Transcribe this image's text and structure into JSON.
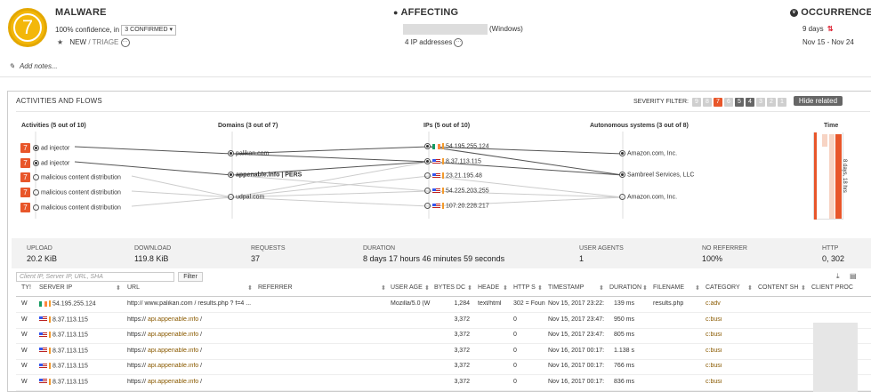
{
  "header": {
    "severity": "7",
    "title": "MALWARE",
    "confidence_text": "100% confidence, in",
    "confirmed_select": "3 CONFIRMED ▾",
    "status_new": "NEW",
    "status_triage": "/ TRIAGE",
    "add_notes": "Add notes...",
    "affecting_title": "AFFECTING",
    "affecting_os": "(Windows)",
    "affecting_ips": "4 IP addresses",
    "occurrence_title": "OCCURRENCE",
    "occurrence_days": "9 days",
    "occurrence_range": "Nov 15 - Nov 24"
  },
  "panel": {
    "title": "ACTIVITIES AND FLOWS",
    "severity_filter_label": "SEVERITY FILTER:",
    "severity_filter": [
      {
        "label": "9",
        "color": "#cfcfcf"
      },
      {
        "label": "8",
        "color": "#cfcfcf"
      },
      {
        "label": "7",
        "color": "#e8562a"
      },
      {
        "label": "6",
        "color": "#cfcfcf"
      },
      {
        "label": "5",
        "color": "#666666"
      },
      {
        "label": "4",
        "color": "#666666"
      },
      {
        "label": "3",
        "color": "#cfcfcf"
      },
      {
        "label": "2",
        "color": "#cfcfcf"
      },
      {
        "label": "1",
        "color": "#cfcfcf"
      }
    ],
    "hide_related": "Hide related"
  },
  "flows": {
    "activities_header": "Activities (5 out of 10)",
    "domains_header": "Domains (3 out of 7)",
    "ips_header": "IPs (5 out of 10)",
    "as_header": "Autonomous systems (3 out of 8)",
    "time_header": "Time",
    "time_label": "8 days, 18 hrs",
    "activities": [
      {
        "sev": "7",
        "label": "ad injector"
      },
      {
        "sev": "7",
        "label": "ad injector"
      },
      {
        "sev": "7",
        "label": "malicious content distribution"
      },
      {
        "sev": "7",
        "label": "malicious content distribution"
      },
      {
        "sev": "7",
        "label": "malicious content distribution"
      }
    ],
    "domains": [
      "palikan.com",
      "appenable.info | PERS",
      "udpal.com"
    ],
    "ips": [
      "54.195.255.124",
      "8.37.113.115",
      "23.21.195.48",
      "54.225.203.255",
      "107.20.228.217"
    ],
    "as": [
      "Amazon.com, Inc.",
      "Sambreel Services, LLC",
      "Amazon.com, Inc."
    ]
  },
  "stats": [
    {
      "label": "UPLOAD",
      "value": "20.2 KiB"
    },
    {
      "label": "DOWNLOAD",
      "value": "119.8 KiB"
    },
    {
      "label": "REQUESTS",
      "value": "37"
    },
    {
      "label": "DURATION",
      "value": "8 days 17 hours 46 minutes 59 seconds"
    },
    {
      "label": "USER AGENTS",
      "value": "1"
    },
    {
      "label": "NO REFERRER",
      "value": "100%"
    },
    {
      "label": "HTTP",
      "value": "0, 302"
    }
  ],
  "filter": {
    "placeholder": "Client IP, Server IP, URL, SHA",
    "button": "Filter"
  },
  "table": {
    "columns": [
      "TY!",
      "SERVER IP",
      "URL",
      "REFERRER",
      "USER AGE",
      "BYTES DC",
      "HEADE",
      "HTTP S",
      "TIMESTAMP",
      "DURATION",
      "FILENAME",
      "CATEGORY",
      "CONTENT SH",
      "CLIENT PROC"
    ],
    "rows": [
      {
        "type": "W",
        "ip": "54.195.255.124",
        "url_pre": "http:// www.palikan.com / results.php ? f=4 ...",
        "url_dom": "",
        "url_post": "",
        "ua": "Mozilla/5.0 (W",
        "bytes": "1,284",
        "header": "text/html",
        "http": "302 = Foun",
        "ts": "Nov 15, 2017 23:22:",
        "dur": "139 ms",
        "file": "results.php",
        "cat": "c:adv"
      },
      {
        "type": "W",
        "ip": "8.37.113.115",
        "url_pre": "https:// ",
        "url_dom": "api.appenable.info",
        "url_post": " /",
        "ua": "",
        "bytes": "3,372",
        "header": "",
        "http": "0",
        "ts": "Nov 15, 2017 23:47:",
        "dur": "950 ms",
        "file": "",
        "cat": "c:busi"
      },
      {
        "type": "W",
        "ip": "8.37.113.115",
        "url_pre": "https:// ",
        "url_dom": "api.appenable.info",
        "url_post": " /",
        "ua": "",
        "bytes": "3,372",
        "header": "",
        "http": "0",
        "ts": "Nov 15, 2017 23:47:",
        "dur": "805 ms",
        "file": "",
        "cat": "c:busi"
      },
      {
        "type": "W",
        "ip": "8.37.113.115",
        "url_pre": "https:// ",
        "url_dom": "api.appenable.info",
        "url_post": " /",
        "ua": "",
        "bytes": "3,372",
        "header": "",
        "http": "0",
        "ts": "Nov 16, 2017 00:17:",
        "dur": "1.138 s",
        "file": "",
        "cat": "c:busi"
      },
      {
        "type": "W",
        "ip": "8.37.113.115",
        "url_pre": "https:// ",
        "url_dom": "api.appenable.info",
        "url_post": " /",
        "ua": "",
        "bytes": "3,372",
        "header": "",
        "http": "0",
        "ts": "Nov 16, 2017 00:17:",
        "dur": "766 ms",
        "file": "",
        "cat": "c:busi"
      },
      {
        "type": "W",
        "ip": "8.37.113.115",
        "url_pre": "https:// ",
        "url_dom": "api.appenable.info",
        "url_post": " /",
        "ua": "",
        "bytes": "3,372",
        "header": "",
        "http": "0",
        "ts": "Nov 16, 2017 00:17:",
        "dur": "836 ms",
        "file": "",
        "cat": "c:busi"
      }
    ]
  }
}
